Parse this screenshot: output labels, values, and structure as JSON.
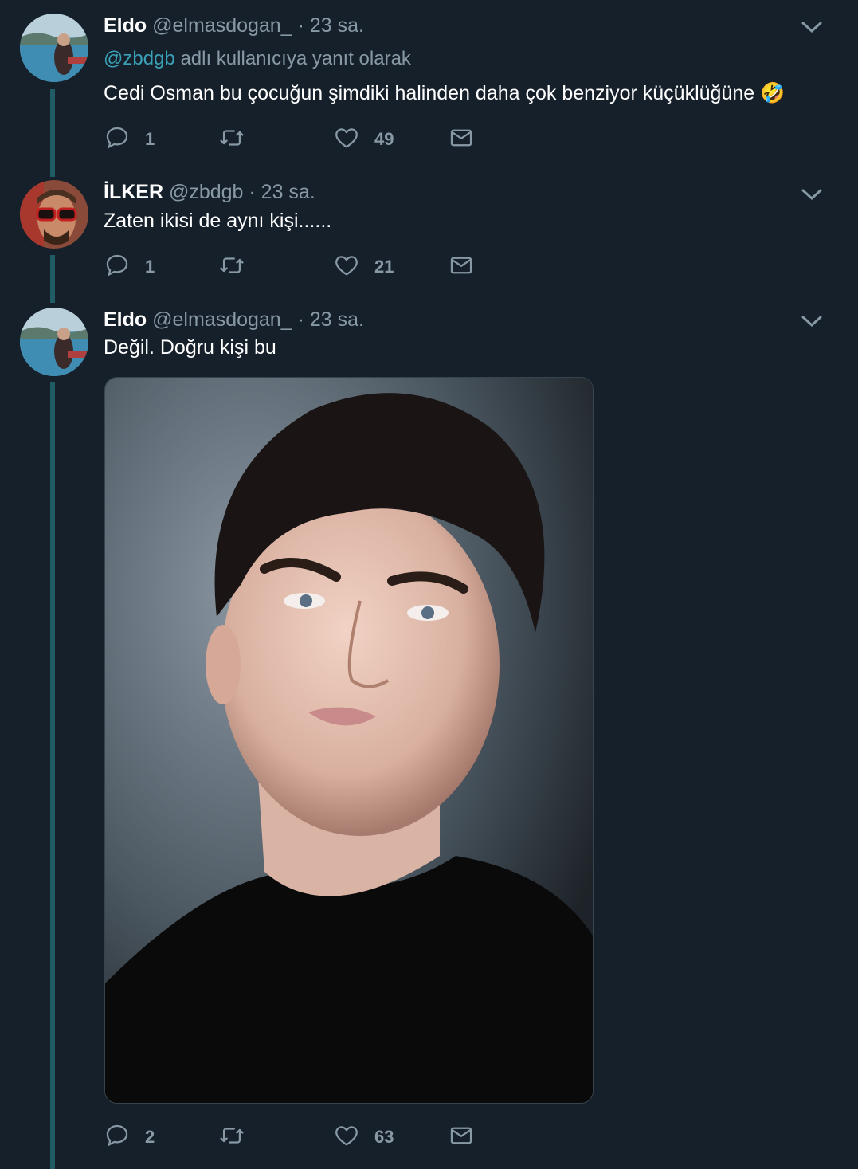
{
  "tweets": [
    {
      "name": "Eldo",
      "handle": "@elmasdogan_",
      "time": "· 23 sa.",
      "reply_mention": "@zbdgb",
      "reply_suffix": "adlı kullanıcıya yanıt olarak",
      "text": "Cedi Osman bu çocuğun şimdiki halinden daha çok benziyor küçüklüğüne",
      "emoji": "🤣",
      "reply_count": "1",
      "retweet_count": "",
      "like_count": "49"
    },
    {
      "name": "İLKER",
      "handle": "@zbdgb",
      "time": "· 23 sa.",
      "text": "Zaten ikisi de aynı kişi......",
      "reply_count": "1",
      "retweet_count": "",
      "like_count": "21"
    },
    {
      "name": "Eldo",
      "handle": "@elmasdogan_",
      "time": "· 23 sa.",
      "text": "Değil. Doğru kişi bu",
      "reply_count": "2",
      "retweet_count": "",
      "like_count": "63"
    }
  ],
  "icons": {
    "reply": "reply-icon",
    "retweet": "retweet-icon",
    "like": "heart-icon",
    "message": "envelope-icon",
    "more": "chevron-down-icon"
  },
  "colors": {
    "background": "#15202b",
    "secondary_text": "#8899a6",
    "mention": "#3aa0b6",
    "thread_line": "#1f5c63"
  }
}
